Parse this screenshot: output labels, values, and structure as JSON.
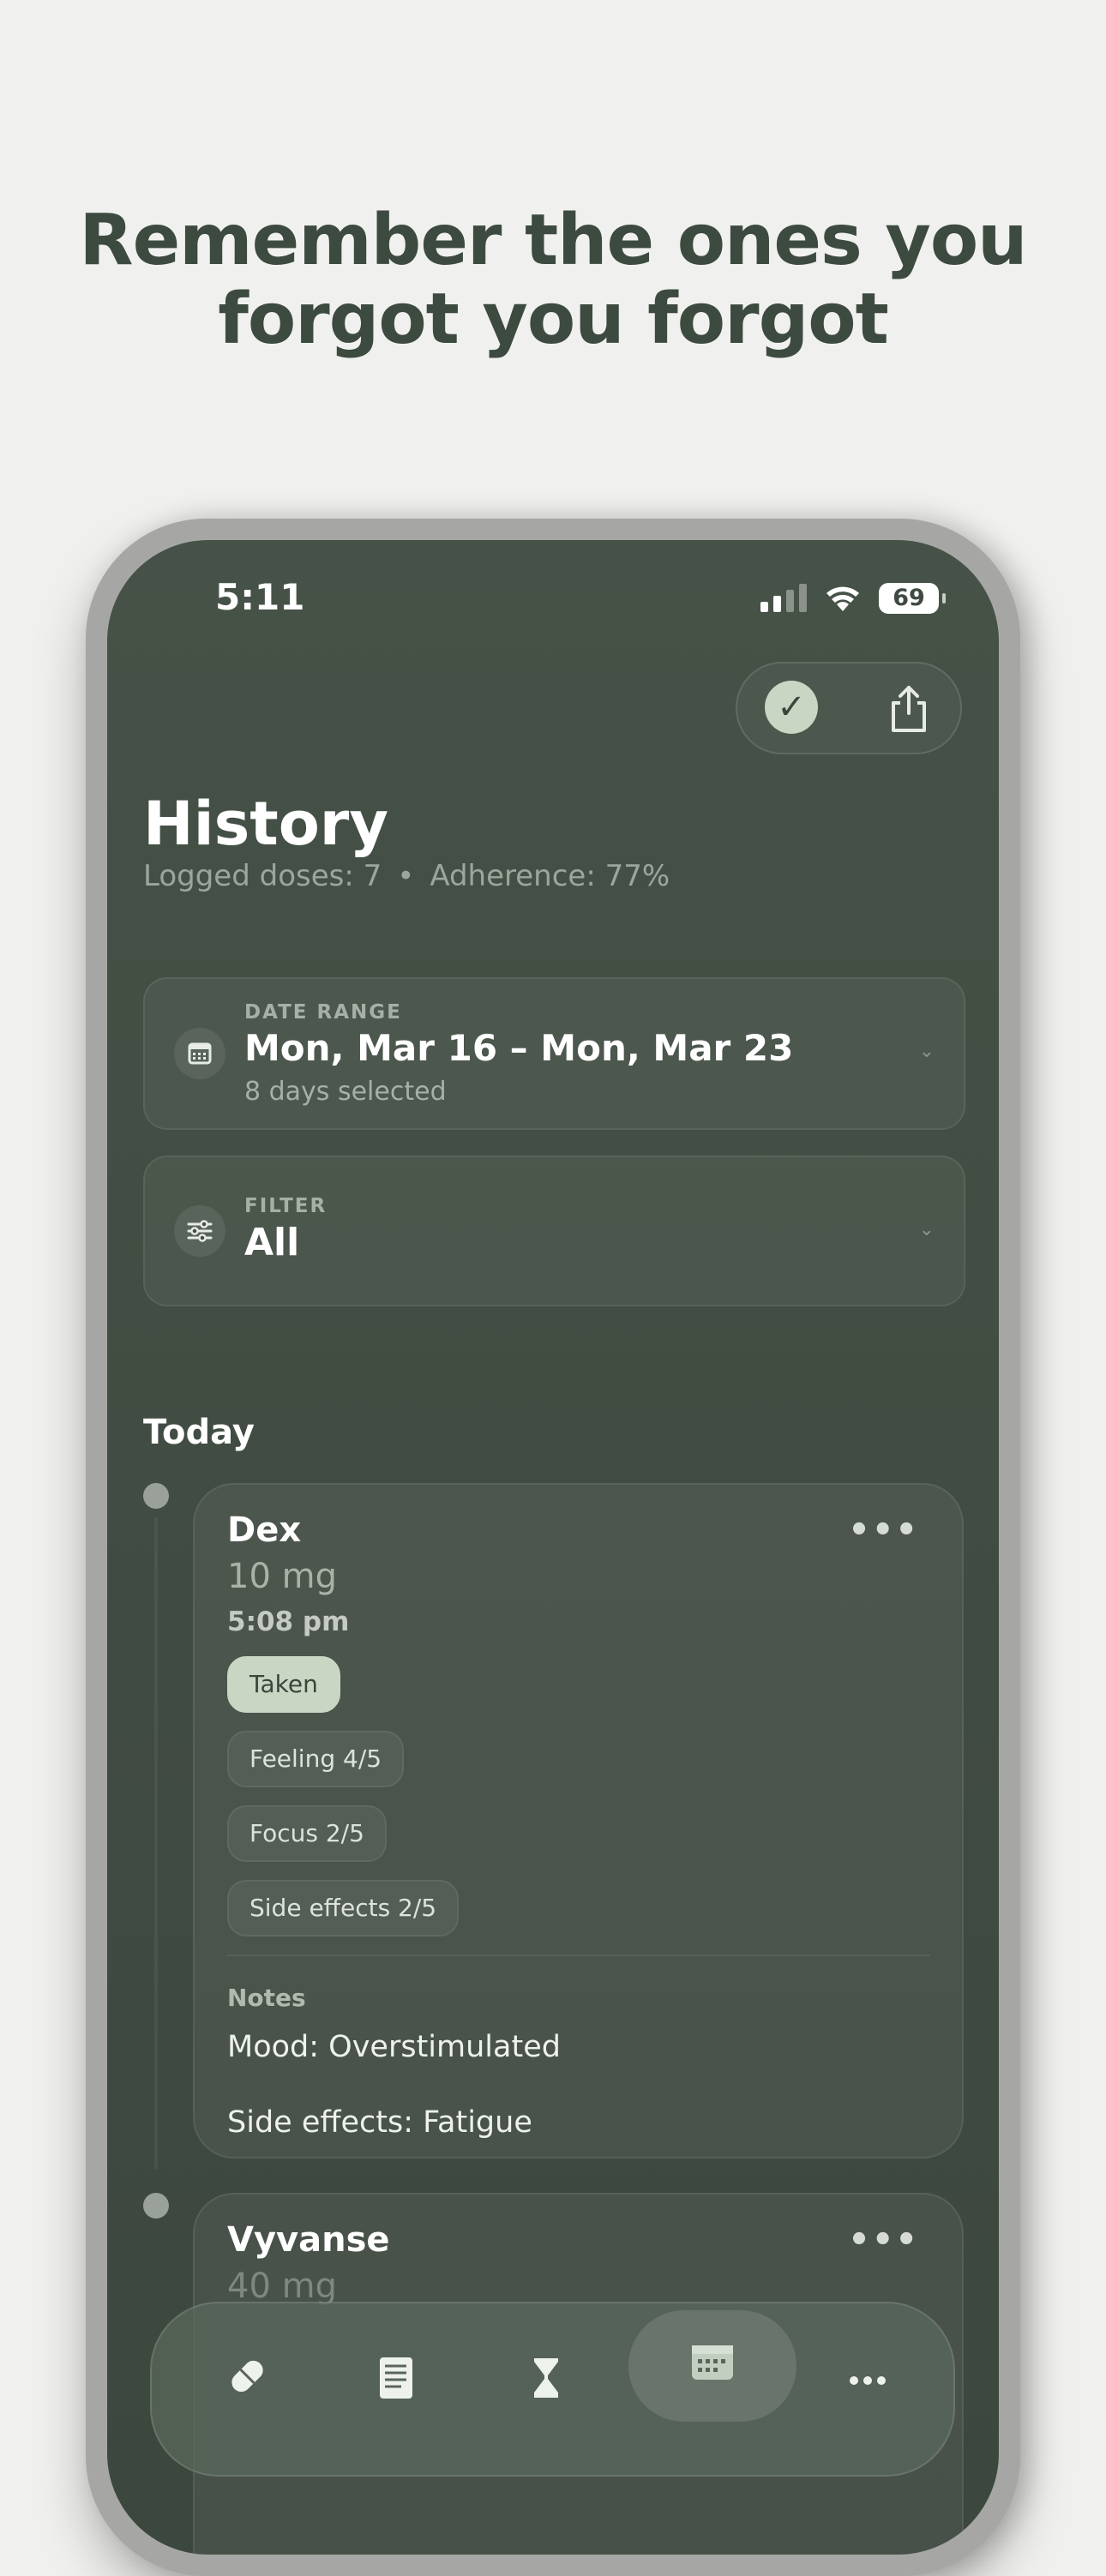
{
  "headline": {
    "line1": "Remember the ones you",
    "line2": "forgot you forgot"
  },
  "status_bar": {
    "time": "5:11",
    "battery": "69"
  },
  "header": {
    "title": "History",
    "logged_doses": "Logged doses: 7",
    "separator": "•",
    "adherence": "Adherence: 77%"
  },
  "date_range": {
    "label": "DATE RANGE",
    "value": "Mon, Mar 16 – Mon, Mar 23",
    "sub": "8 days selected"
  },
  "filter": {
    "label": "FILTER",
    "value": "All"
  },
  "section": {
    "today": "Today"
  },
  "doses": [
    {
      "name": "Dex",
      "amount": "10 mg",
      "time": "5:08 pm",
      "status": "Taken",
      "chips": [
        "Feeling 4/5",
        "Focus 2/5",
        "Side effects 2/5"
      ],
      "notes_label": "Notes",
      "notes": [
        "Mood: Overstimulated",
        "Side effects: Fatigue"
      ]
    },
    {
      "name": "Vyvanse",
      "amount": "40 mg"
    }
  ],
  "more_glyph": "•••",
  "icons": {
    "check": "checkmark-icon",
    "share": "share-icon",
    "calendar": "calendar-icon",
    "filter": "sliders-icon",
    "chevron": "chevron-down-icon",
    "tabs": [
      "pill-icon",
      "journal-icon",
      "hourglass-icon",
      "calendar-icon",
      "more-icon"
    ]
  },
  "colors": {
    "background": "#f0f1ee",
    "headline": "#3d4a40",
    "screen": "#434e44",
    "accent": "#c9d6c3"
  }
}
